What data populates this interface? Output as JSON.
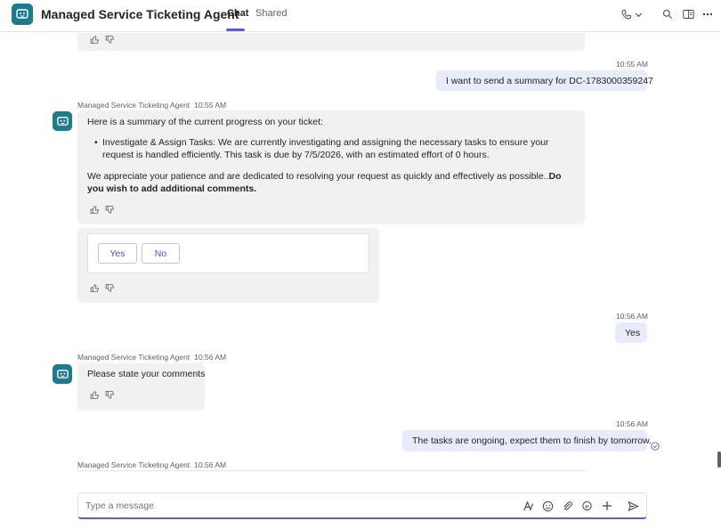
{
  "header": {
    "title": "Managed Service Ticketing Agent",
    "tabs": [
      {
        "label": "Chat",
        "active": true
      },
      {
        "label": "Shared",
        "active": false
      }
    ],
    "icons": [
      "call-icon",
      "chevron-down-icon",
      "search-icon",
      "popout-icon",
      "more-icon"
    ]
  },
  "messages": {
    "m1": {
      "time": "10:55 AM",
      "text": "I want to send a summary for DC-1783000359247"
    },
    "m2": {
      "sender": "Managed Service Ticketing Agent",
      "time": "10:55 AM",
      "intro": "Here is a summary of the current progress on your ticket:",
      "bullet": "Investigate & Assign Tasks: We are currently investigating and assigning the necessary tasks to ensure your request is handled efficiently. This task is due by 7/5/2026, with an estimated effort of 0 hours.",
      "closing": "We appreciate your patience and are dedicated to resolving your request as quickly and effectively as possible..",
      "question": "Do you wish to add additional comments."
    },
    "m3": {
      "yes_label": "Yes",
      "no_label": "No"
    },
    "m4": {
      "time": "10:56 AM",
      "text": "Yes"
    },
    "m5": {
      "sender": "Managed Service Ticketing Agent",
      "time": "10:56 AM",
      "text": "Please state your comments"
    },
    "m6": {
      "time": "10:56 AM",
      "text": "The tasks are ongoing, expect them to finish by tomorrow."
    },
    "m7": {
      "sender": "Managed Service Ticketing Agent",
      "time": "10:56 AM"
    }
  },
  "compose": {
    "placeholder": "Type a message",
    "icons": [
      "format-icon",
      "emoji-icon",
      "attach-icon",
      "loop-icon",
      "add-icon",
      "send-icon"
    ]
  },
  "colors": {
    "accent": "#5b5fc7",
    "bot_bubble": "#f1f1f1",
    "user_bubble": "#e8ebfa",
    "avatar": "#1f7a8c"
  }
}
